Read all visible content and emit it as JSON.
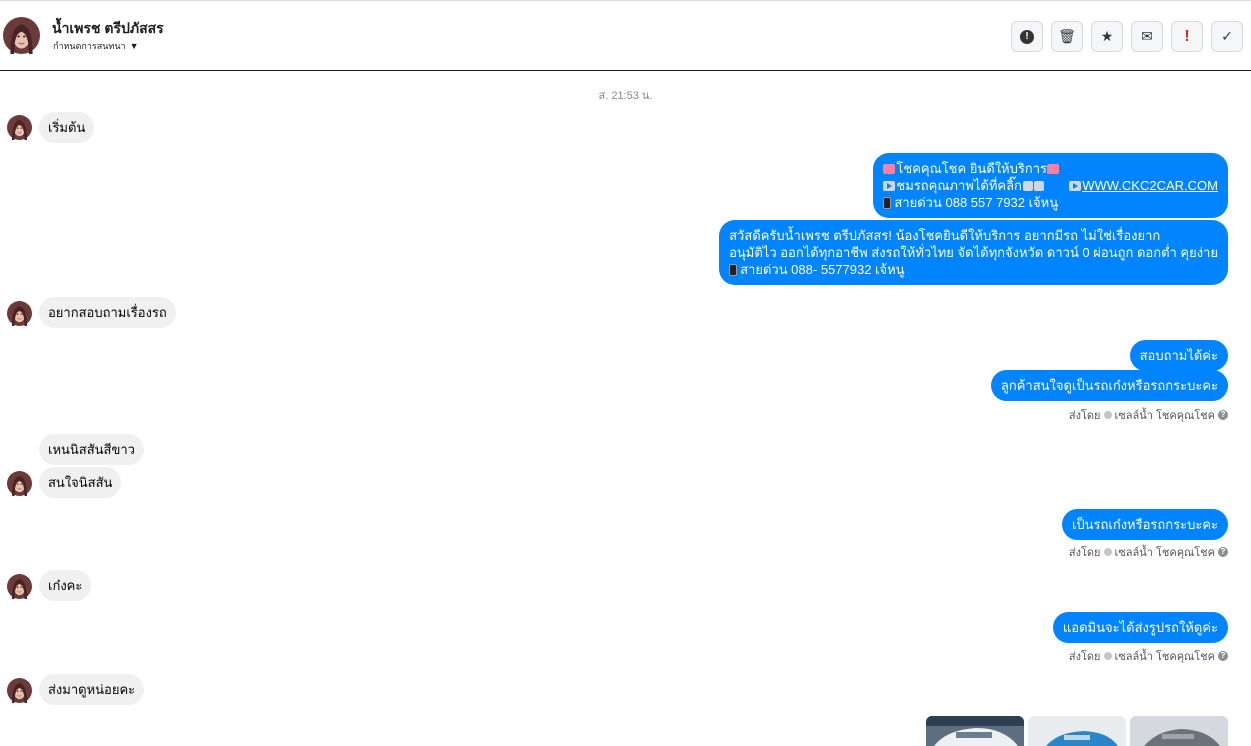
{
  "header": {
    "contact_name": "น้ำเพรช ตรีปภัสสร",
    "subtitle": "กำหนดการสนทนา",
    "actions": [
      {
        "name": "report-button",
        "glyph": "!"
      },
      {
        "name": "delete-button",
        "glyph": "🗑"
      },
      {
        "name": "star-button",
        "glyph": "★"
      },
      {
        "name": "mark-unread-button",
        "glyph": "✉"
      },
      {
        "name": "spam-button",
        "glyph": "!"
      },
      {
        "name": "mark-done-button",
        "glyph": "✓"
      }
    ]
  },
  "timestamp": "ส. 21:53 น.",
  "messages": {
    "m1": "เริ่มต้น",
    "o1_l1": "โชคคุณโชค ยินดีให้บริการ",
    "o1_l2": "ชมรถคุณภาพได้ที่คลิ๊ก",
    "o1_link": "WWW.CKC2CAR.COM",
    "o1_l3": "สายด่วน 088 557 7932 เจ้หนู",
    "o2_l1": "สวัสดีครับน้ำเพรช ตรีปภัสสร! น้องโชคยินดีให้บริการ อยากมีรถ ไม่ใช่เรื่องยาก",
    "o2_l2": "อนุมัติไว ออกได้ทุกอาชีพ ส่งรถให้ทั่วไทย จัดได้ทุกจังหวัด ดาวน์ 0  ผ่อนถูก ดอกต่ำ คุยง่าย",
    "o2_l3": "สายด่วน 088- 5577932 เจ้หนู",
    "m2": "อยากสอบถามเรื่องรถ",
    "o3": "สอบถามได้ค่ะ",
    "o4": "ลูกค้าสนใจดูเป็นรถเก๋งหรือรถกระบะคะ",
    "m3": "เหนนิสสันสีขาว",
    "m4": "สนใจนิสสัน",
    "o5": "เป็นรถเก๋งหรือรถกระบะคะ",
    "m5": "เก๋งคะ",
    "o6": "แอดมินจะได้ส่งรูปรถให้ดูค่ะ",
    "m6": "ส่งมาดูหน่อยคะ"
  },
  "sent_by": {
    "prefix": "ส่งโดย",
    "agent": "เซลล์น้ำ โชคคุณโชค",
    "help": "?"
  },
  "icons": {
    "avatar": "avatar-photo",
    "caret": "caret-down-icon",
    "photos": [
      "car-photo-white",
      "car-photo-blue",
      "car-photo-grey"
    ]
  },
  "colors": {
    "outgoing_bubble": "#0084ff",
    "incoming_bubble": "#f1f0f0",
    "spam_icon": "#e02020"
  }
}
